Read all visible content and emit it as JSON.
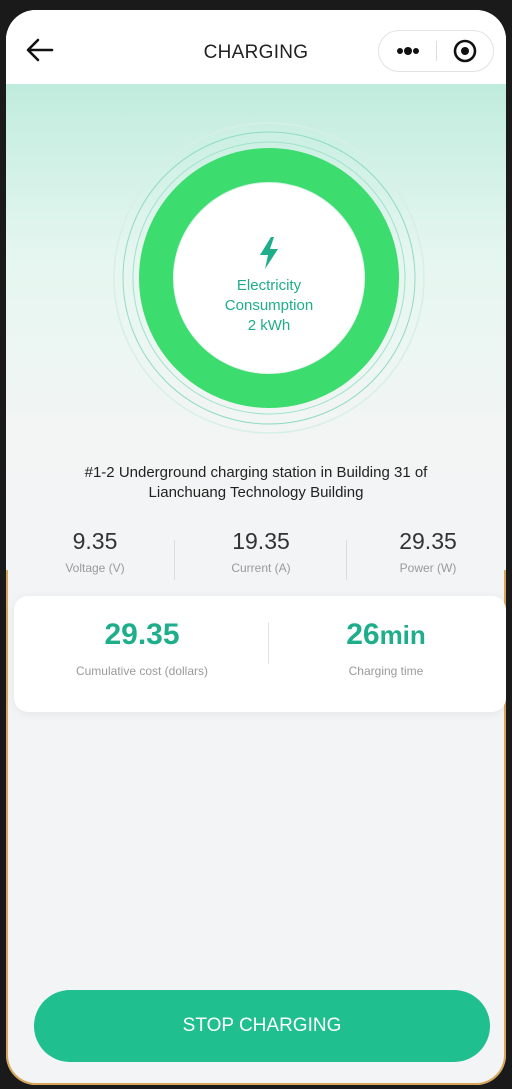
{
  "header": {
    "title": "CHARGING",
    "back_icon": "arrow-left-icon",
    "more_icon": "more-dots-icon",
    "target_icon": "target-circle-icon"
  },
  "gauge": {
    "label_line1": "Electricity",
    "label_line2": "Consumption",
    "value": "2 kWh",
    "icon": "lightning-bolt-icon",
    "ring_color": "#3ddc6e",
    "accent_color": "#1fae8c"
  },
  "station": {
    "line1": "#1-2 Underground charging station in Building 31 of",
    "line2": "Lianchuang Technology Building"
  },
  "metrics": [
    {
      "value": "9.35",
      "label": "Voltage (V)"
    },
    {
      "value": "19.35",
      "label": "Current (A)"
    },
    {
      "value": "29.35",
      "label": "Power (W)"
    }
  ],
  "summary": {
    "cost_value": "29.35",
    "cost_label": "Cumulative cost (dollars)",
    "time_value": "26",
    "time_unit": "min",
    "time_label": "Charging time"
  },
  "actions": {
    "stop_label": "STOP CHARGING",
    "button_color": "#1fbf8f"
  }
}
